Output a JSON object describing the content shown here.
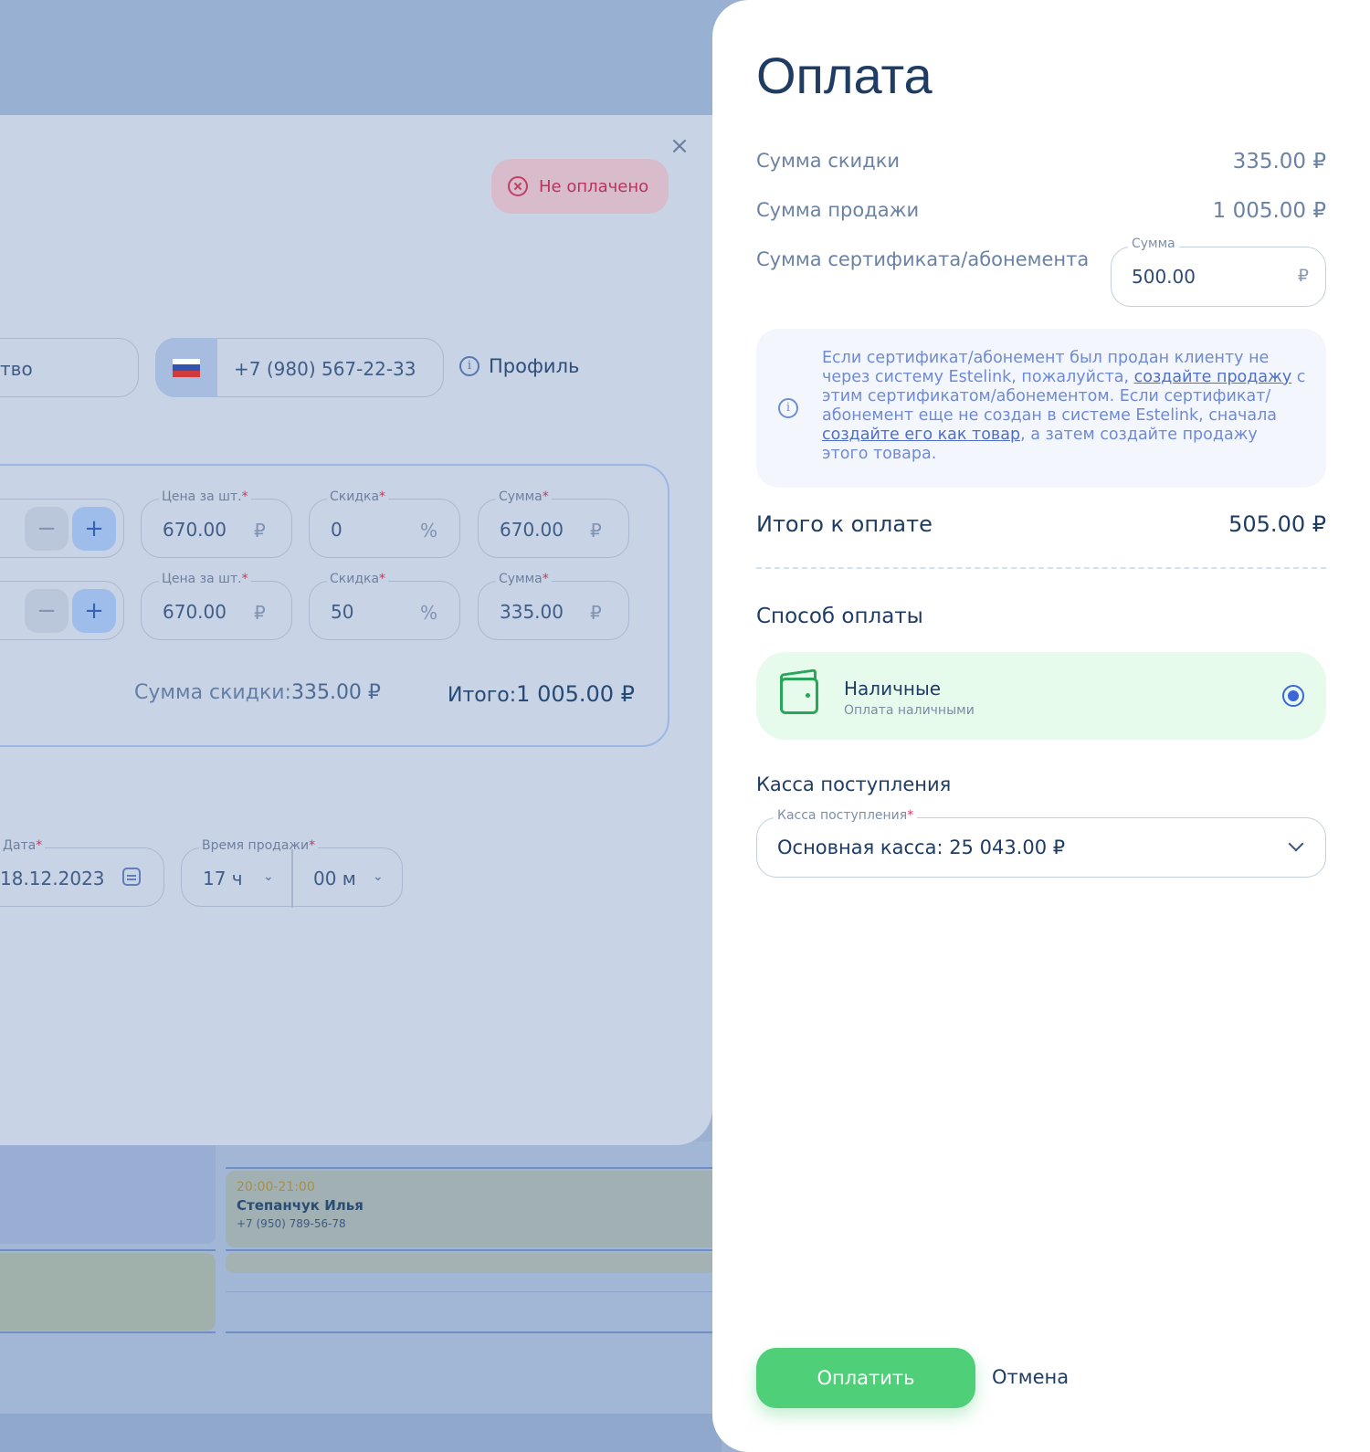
{
  "background": {
    "status_badge": "Не оплачено",
    "client_field_partial": "тво",
    "phone": "+7 (980) 567-22-33",
    "profile_link": "Профиль",
    "items": [
      {
        "price_label": "Цена за шт.",
        "price": "670.00",
        "discount_label": "Скидка",
        "discount": "0",
        "sum_label": "Сумма",
        "sum": "670.00"
      },
      {
        "price_label": "Цена за шт.",
        "price": "670.00",
        "discount_label": "Скидка",
        "discount": "50",
        "sum_label": "Сумма",
        "sum": "335.00"
      }
    ],
    "currency": "₽",
    "percent": "%",
    "required_mark": "*",
    "minus": "−",
    "plus": "+",
    "discount_total_label": "Сумма скидки:",
    "discount_total_value": "335.00 ₽",
    "grand_total_label": "Итого:",
    "grand_total_value": "1 005.00 ₽",
    "date_label": "Дата",
    "date_value": "18.12.2023",
    "time_label": "Время продажи",
    "hour_value": "17 ч",
    "minute_value": "00 м",
    "event": {
      "time": "20:00-21:00",
      "name": "Степанчук Илья",
      "phone": "+7 (950) 789-56-78"
    }
  },
  "drawer": {
    "title": "Оплата",
    "discount_sum_label": "Сумма скидки",
    "discount_sum_value": "335.00 ₽",
    "sale_sum_label": "Сумма продажи",
    "sale_sum_value": "1 005.00 ₽",
    "cert_sum_label": "Сумма сертификата/абонемента",
    "cert_field_label": "Сумма",
    "cert_field_value": "500.00",
    "cert_field_unit": "₽",
    "info": {
      "part1": "Если сертификат/абонемент был продан клиенту не через систему Estelink, пожалуйста, ",
      "link1": "создайте продажу",
      "part2": " с этим сертификатом/абонементом. Если сертификат/абонемент еще не создан в системе Estelink, сначала ",
      "link2": "создайте его как товар",
      "part3": ", а затем создайте продажу этого товара."
    },
    "total_label": "Итого к оплате",
    "total_value": "505.00 ₽",
    "payment_method_title": "Способ оплаты",
    "method_name": "Наличные",
    "method_sub": "Оплата наличными",
    "cashbox_title": "Касса поступления",
    "cashbox_field_label": "Касса поступления",
    "cashbox_required": "*",
    "cashbox_value": "Основная касса: 25 043.00 ₽",
    "pay_button": "Оплатить",
    "cancel_button": "Отмена"
  },
  "colors": {
    "accent_green": "#4fcf78",
    "brand_blue": "#1f3c63",
    "unpaid_red": "#c33e66",
    "radio_blue": "#3a66d8"
  },
  "icons": [
    "close-icon",
    "x-circle-icon",
    "info-icon",
    "flag-ru-icon",
    "calendar-icon",
    "chevron-down-icon",
    "wallet-icon",
    "radio-selected-icon"
  ]
}
